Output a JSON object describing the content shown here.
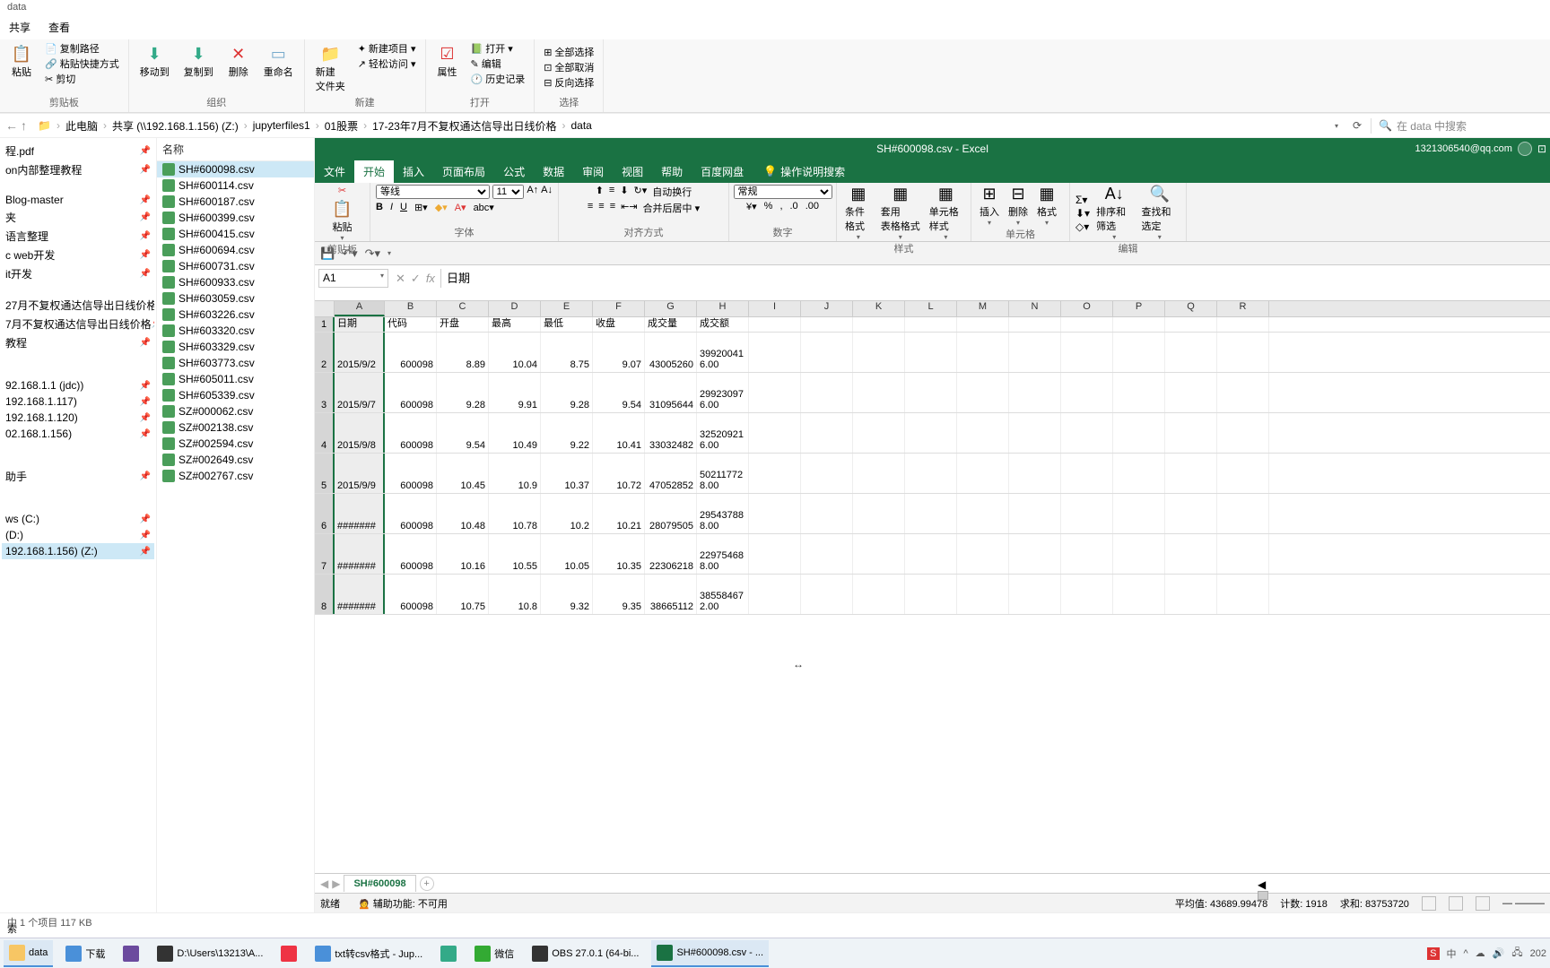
{
  "explorer": {
    "title": "data",
    "tabs": [
      "共享",
      "查看"
    ],
    "ribbon": {
      "clipboard": {
        "paste": "粘贴",
        "copy_path": "复制路径",
        "paste_shortcut": "粘贴快捷方式",
        "cut": "剪切",
        "label": "剪贴板"
      },
      "organize": {
        "move": "移动到",
        "copy": "复制到",
        "delete": "删除",
        "rename": "重命名",
        "label": "组织"
      },
      "new": {
        "folder": "新建\n文件夹",
        "item": "新建项目 ▾",
        "easy": "轻松访问 ▾",
        "label": "新建"
      },
      "open": {
        "props": "属性",
        "open": "打开 ▾",
        "edit": "编辑",
        "history": "历史记录",
        "label": "打开"
      },
      "select": {
        "all": "全部选择",
        "none": "全部取消",
        "invert": "反向选择",
        "label": "选择"
      }
    },
    "breadcrumb": [
      "此电脑",
      "共享 (\\\\192.168.1.156) (Z:)",
      "jupyterfiles1",
      "01股票",
      "17-23年7月不复权通达信导出日线价格",
      "data"
    ],
    "search_placeholder": "在 data 中搜索",
    "left_items": [
      "程.pdf",
      "on内部整理教程",
      "",
      "Blog-master",
      "夹",
      "语言整理",
      "c web开发",
      "it开发",
      "",
      "27月不复权通达信导出日线价格",
      "7月不复权通达信导出日线价格",
      "教程",
      "",
      "",
      "92.168.1.1 (jdc))",
      "192.168.1.117)",
      "192.168.1.120)",
      "02.168.1.156)",
      "",
      "",
      "助手",
      "",
      "",
      "ws (C:)",
      "(D:)",
      "192.168.1.156) (Z:)"
    ],
    "files_header": "名称",
    "files": [
      "SH#600098.csv",
      "SH#600114.csv",
      "SH#600187.csv",
      "SH#600399.csv",
      "SH#600415.csv",
      "SH#600694.csv",
      "SH#600731.csv",
      "SH#600933.csv",
      "SH#603059.csv",
      "SH#603226.csv",
      "SH#603320.csv",
      "SH#603329.csv",
      "SH#603773.csv",
      "SH#605011.csv",
      "SH#605339.csv",
      "SZ#000062.csv",
      "SZ#002138.csv",
      "SZ#002594.csv",
      "SZ#002649.csv",
      "SZ#002767.csv"
    ],
    "status": "中 1 个项目  117 KB",
    "search_label": "索"
  },
  "excel": {
    "title": "SH#600098.csv - Excel",
    "user": "1321306540@qq.com",
    "menus": [
      "文件",
      "开始",
      "插入",
      "页面布局",
      "公式",
      "数据",
      "审阅",
      "视图",
      "帮助",
      "百度网盘"
    ],
    "tell_me": "操作说明搜索",
    "ribbon": {
      "clipboard": {
        "paste": "粘贴",
        "label": "剪贴板"
      },
      "font": {
        "name": "等线",
        "size": "11",
        "label": "字体"
      },
      "align": {
        "wrap": "自动换行",
        "merge": "合并后居中 ▾",
        "label": "对齐方式"
      },
      "number": {
        "format": "常规",
        "label": "数字"
      },
      "styles": {
        "cond": "条件格式",
        "table": "套用\n表格格式",
        "cell": "单元格样式",
        "label": "样式"
      },
      "cells": {
        "insert": "插入",
        "delete": "删除",
        "format": "格式",
        "label": "单元格"
      },
      "edit": {
        "sort": "排序和筛选",
        "find": "查找和选定",
        "label": "编辑"
      }
    },
    "name_box": "A1",
    "formula": "日期",
    "columns": [
      "A",
      "B",
      "C",
      "D",
      "E",
      "F",
      "G",
      "H",
      "I",
      "J",
      "K",
      "L",
      "M",
      "N",
      "O",
      "P",
      "Q",
      "R"
    ],
    "headers": [
      "日期",
      "代码",
      "开盘",
      "最高",
      "最低",
      "收盘",
      "成交量",
      "成交额"
    ],
    "rows": [
      {
        "n": 2,
        "c": [
          "2015/9/2",
          "600098",
          "8.89",
          "10.04",
          "8.75",
          "9.07",
          "43005260",
          "399200416.00"
        ]
      },
      {
        "n": 3,
        "c": [
          "2015/9/7",
          "600098",
          "9.28",
          "9.91",
          "9.28",
          "9.54",
          "31095644",
          "299230976.00"
        ]
      },
      {
        "n": 4,
        "c": [
          "2015/9/8",
          "600098",
          "9.54",
          "10.49",
          "9.22",
          "10.41",
          "33032482",
          "325209216.00"
        ]
      },
      {
        "n": 5,
        "c": [
          "2015/9/9",
          "600098",
          "10.45",
          "10.9",
          "10.37",
          "10.72",
          "47052852",
          "502117728.00"
        ]
      },
      {
        "n": 6,
        "c": [
          "#######",
          "600098",
          "10.48",
          "10.78",
          "10.2",
          "10.21",
          "28079505",
          "295437888.00"
        ]
      },
      {
        "n": 7,
        "c": [
          "#######",
          "600098",
          "10.16",
          "10.55",
          "10.05",
          "10.35",
          "22306218",
          "229754688.00"
        ]
      },
      {
        "n": 8,
        "c": [
          "#######",
          "600098",
          "10.75",
          "10.8",
          "9.32",
          "9.35",
          "38665112",
          "385584672.00"
        ]
      }
    ],
    "sheet": "SH#600098",
    "status": {
      "ready": "就绪",
      "acc": "辅助功能: 不可用",
      "avg": "平均值: 43689.99478",
      "count": "计数: 1918",
      "sum": "求和: 83753720"
    }
  },
  "taskbar": {
    "items": [
      {
        "label": "data",
        "color": "#f7c664"
      },
      {
        "label": "下载",
        "color": "#4a90d9"
      },
      {
        "label": "",
        "color": "#6b4a9e"
      },
      {
        "label": "D:\\Users\\13213\\A...",
        "color": "#333"
      },
      {
        "label": "",
        "color": "#e34"
      },
      {
        "label": "txt转csv格式 - Jup...",
        "color": "#4a90d9"
      },
      {
        "label": "",
        "color": "#3a8"
      },
      {
        "label": "微信",
        "color": "#3a3"
      },
      {
        "label": "OBS 27.0.1 (64-bi...",
        "color": "#333"
      },
      {
        "label": "SH#600098.csv - ...",
        "color": "#1a7243"
      }
    ],
    "ime": "中",
    "time": "202"
  }
}
